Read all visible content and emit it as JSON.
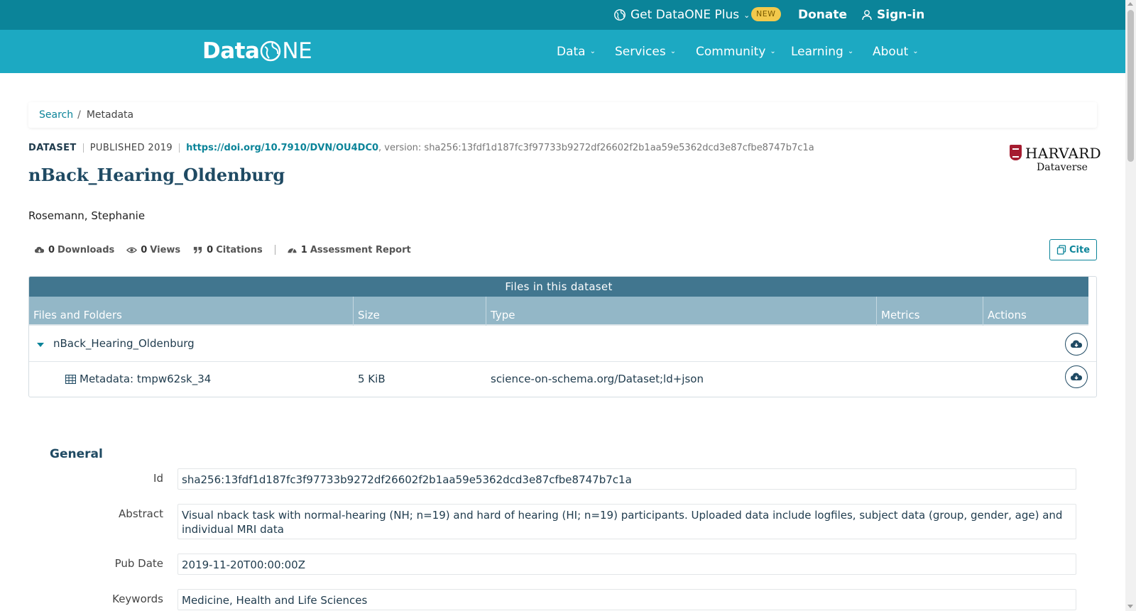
{
  "topbar": {
    "plus_label": "Get DataONE Plus",
    "new_badge": "NEW",
    "donate": "Donate",
    "signin": "Sign-in"
  },
  "nav": {
    "logo_data": "Data",
    "logo_one": "NE",
    "items": [
      "Data",
      "Services",
      "Community",
      "Learning",
      "About"
    ]
  },
  "breadcrumb": {
    "search": "Search",
    "separator": "/",
    "current": "Metadata"
  },
  "dataset": {
    "type": "DATASET",
    "published": "PUBLISHED 2019",
    "doi": "https://doi.org/10.7910/DVN/OU4DC0",
    "version": ", version: sha256:13fdf1d187fc3f97733b9272df26602f2b1aa59e5362dcd3e87cfbe8747b7c1a",
    "title": "nBack_Hearing_Oldenburg",
    "authors": "Rosemann, Stephanie"
  },
  "repository": {
    "name": "HARVARD",
    "sub": "Dataverse"
  },
  "metrics": {
    "downloads_count": "0",
    "downloads_label": "Downloads",
    "views_count": "0",
    "views_label": "Views",
    "citations_count": "0",
    "citations_label": "Citations",
    "assessment_count": "1",
    "assessment_label": "Assessment Report"
  },
  "cite_button": "Cite",
  "files": {
    "title": "Files in this dataset",
    "columns": [
      "Files and Folders",
      "Size",
      "Type",
      "Metrics",
      "Actions"
    ],
    "folder": {
      "name": "nBack_Hearing_Oldenburg"
    },
    "rows": [
      {
        "name": "Metadata: tmpw62sk_34",
        "size": "5 KiB",
        "type": "science-on-schema.org/Dataset;ld+json"
      }
    ]
  },
  "general": {
    "title": "General",
    "fields": [
      {
        "label": "Id",
        "value": "sha256:13fdf1d187fc3f97733b9272df26602f2b1aa59e5362dcd3e87cfbe8747b7c1a"
      },
      {
        "label": "Abstract",
        "value": "Visual nback task with normal-hearing (NH; n=19) and hard of hearing (HI; n=19) participants. Uploaded data include logfiles, subject data (group, gender, age) and individual MRI data"
      },
      {
        "label": "Pub Date",
        "value": "2019-11-20T00:00:00Z"
      },
      {
        "label": "Keywords",
        "value": "Medicine, Health and Life Sciences"
      }
    ]
  },
  "colors": {
    "topbar": "#0b8499",
    "nav": "#1ca9c2",
    "accent": "#0b8499",
    "table_title": "#41768f",
    "table_head": "#93b7c7",
    "badge": "#f2c94c"
  }
}
